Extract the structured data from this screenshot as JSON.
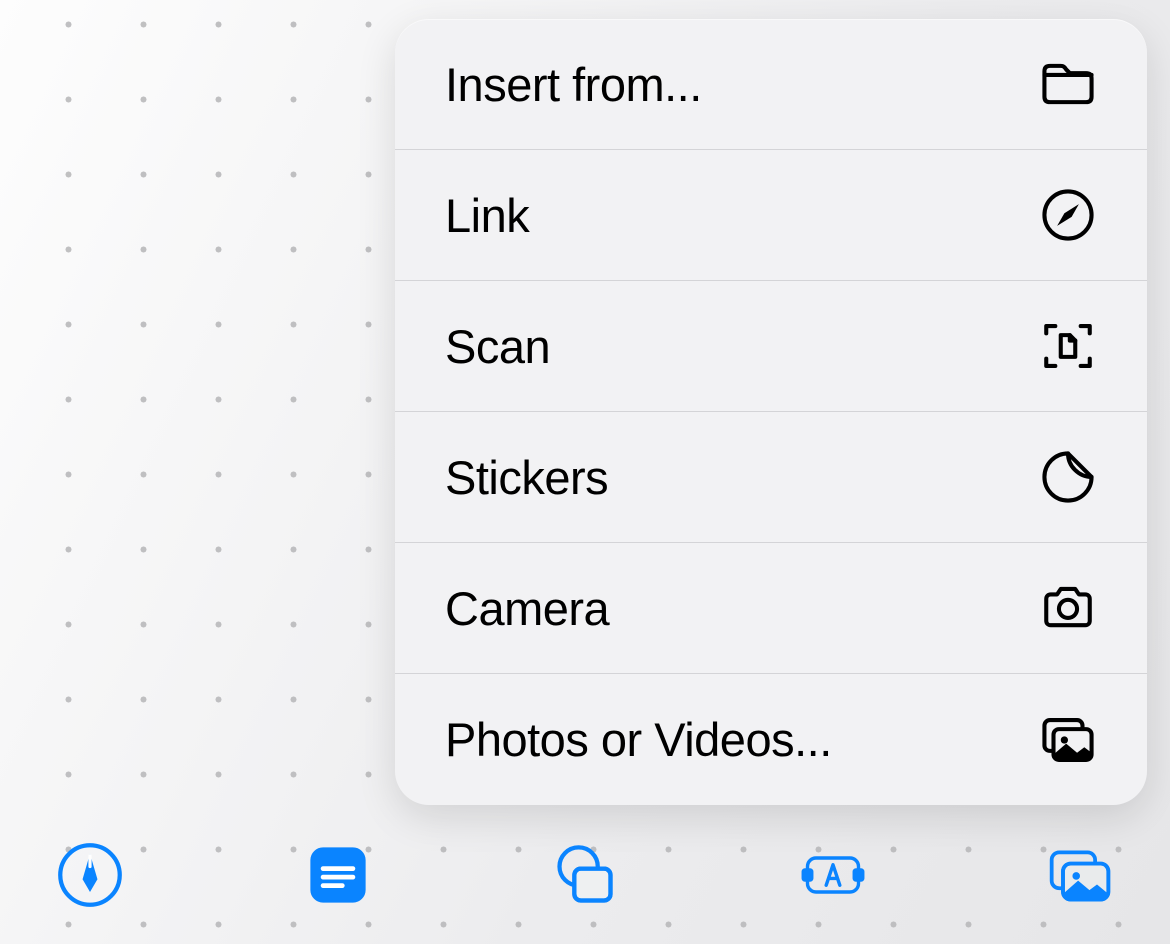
{
  "menu": {
    "items": [
      {
        "label": "Insert from...",
        "icon": "folder-icon"
      },
      {
        "label": "Link",
        "icon": "safari-icon"
      },
      {
        "label": "Scan",
        "icon": "scan-document-icon"
      },
      {
        "label": "Stickers",
        "icon": "sticker-icon"
      },
      {
        "label": "Camera",
        "icon": "camera-icon"
      },
      {
        "label": "Photos or Videos...",
        "icon": "photos-stack-icon"
      }
    ]
  },
  "toolbar": {
    "items": [
      {
        "name": "pen-tool",
        "icon": "pen-circle-icon",
        "active": false
      },
      {
        "name": "note-tool",
        "icon": "note-icon",
        "active": false
      },
      {
        "name": "shapes-tool",
        "icon": "shapes-icon",
        "active": false
      },
      {
        "name": "text-tool",
        "icon": "text-box-icon",
        "active": false
      },
      {
        "name": "media-tool",
        "icon": "photos-stack-icon",
        "active": true
      }
    ]
  },
  "colors": {
    "accent": "#0a84ff",
    "menu_bg": "#f2f2f4",
    "divider": "#d4d4d7",
    "icon_stroke": "#000000"
  }
}
